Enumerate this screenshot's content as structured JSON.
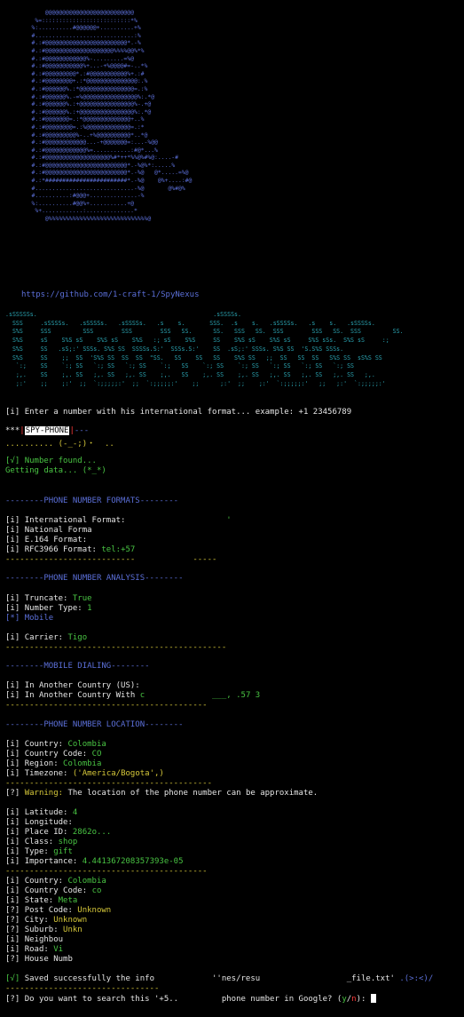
{
  "terminal": {
    "ascii_art": "       @@@@@@@@@@@@@@@@@@@@@@@@@@\n    %=::::::::::::::::::::::::::*%\n   %:..........#@@@@@@+..........+%\n   #.............................:%\n   #.:#@@@@@@@@@@@@@@@@@@@@@@@@*.-%\n   #.:#@@@@@@@@@@@@@@@@@@@@%%%%@@%*%\n   #.:#@@@@@@@@@@@@%-.........=%@\n   #.:#@@@@@@@@@@@%+...-+%@@@@#=-..*%\n   #.:#@@@@@@@@@*.:#@@@@@@@@@@@%+.:#\n   #.:#@@@@@@@@+.:*@@@@@@@@@@@@@@@:.%\n   #.:#@@@@@@%.:*@@@@@@@@@@@@@@@@=.:%\n   #.:#@@@@@@%.-=%@@@@@@@@@@@@@@@@%:.*@\n   #.:#@@@@@@%.:+@@@@@@@@@@@@@@@@%-.+@\n   #.:#@@@@@@%.:+@@@@@@@@@@@@@@@@%:.*@\n   #.:#@@@@@@@=.:*@@@@@@@@@@@@@@+..%\n   #.:#@@@@@@@@=.:%@@@@@@@@@@@@@=.:*\n   #.:#@@@@@@@@@%-..+%@@@@@@@@@@*..*@\n   #.:#@@@@@@@@@@@@...-+@@@@@@@=:...-%@@\n   #.:#@@@@@@@@@@@@%=...........:#@*...%\n   #.:#@@@@@@@@@@@@@@@@@@@%#*++*%%@%#%@:....-#\n   #.:#@@@@@@@@@@@@@@@@@@@@@@@@*.-%@%*:.....%\n   #.:#@@@@@@@@@@@@@@@@@@@@@@@@*.-%@   @*.....=%@\n   #.:*########################*.-%@    @%+....:#@\n   #.............................-%@       @%#@%\n   #..........:#@@@+..............-%\n   %:..........#@@%+...........+@\n    %+............:..............*\n       @%%%%%%%%%%%%%%%%%%%%%%%%%%%%%@",
    "repo_url": "https://github.com/1-craft-1/SpyNexus",
    "logo": ".sSSSSSs.                                                  .sSSSSs.\n  SSS     .sSSSSs.   .sSSSSs.   .sSSSSs.   .s    s.       SSS.  .s    s.   .sSSSSs.   .s    s.   .sSSSSs.\n  S%S     SSS         SSS        SSS        SSS   SS.      SS.   SSS   SS.  SSS        SSS   SS.  SSS         SS.\n  S%S     sS    S%S sS    S%S sS    S%S   :; sS    S%S     SS    S%S sS    S%S sS     S%S sSs.  S%S sS     :;\n  S%S     SS   .sS;:' SSSs. S%S SS  SSSSs.S:'  SSSs.S:'    SS  .sS;:' SSSs. S%S SS  'S.S%S SSSs.\n  S%S     SS    ;;  SS  'S%S SS  SS  SS  \"SS.   SS    SS   SS    S%S SS   ;;  SS   SS  SS   S%S SS  sS%S SS\n   `:;    SS    `:; SS   `:; SS   `:; SS    `:;   SS    `:; SS    `:; SS   `:; SS   `:; SS   `:; SS\n   ;,.    SS    ;,. SS   ;,. SS   ;,. SS    ;,.   SS    ;,. SS    ;,. SS   ;,. SS   ;,. SS   ;,. SS   ;,.\n   ;:'    ;;    ;:'  ;;  `:;;;;;:'  ;;  `:;;;;;:'    ;;      ;:'  ;;    ;:'  `:;;;;;:'   ;;   ;:'  `:;;;;;:'",
    "enter_prompt_tag": "[i]",
    "enter_prompt_text": "Enter a number with his international format... example: +1 23456789",
    "input_prefix": "***",
    "input_badge": "SPY-PHONE",
    "input_suffix": "---",
    "input_value": ".......... (-_-;)・  ..",
    "found_tag": "[√]",
    "found_text": "Number found...",
    "getting_data": "Getting data... (*_*)",
    "formats_header": "--------PHONE NUMBER FORMATS--------",
    "formats": [
      {
        "tag": "[i]",
        "label": "International Format:",
        "value": "                    '"
      },
      {
        "tag": "[i]",
        "label": "National Forma",
        "value": ""
      },
      {
        "tag": "[i]",
        "label": "E.164 Format:",
        "value": ""
      },
      {
        "tag": "[i]",
        "label": "RFC3966 Format:",
        "value": "tel:+57"
      }
    ],
    "formats_sep": "---------------------------            -----",
    "analysis_header": "--------PHONE NUMBER ANALYSIS--------",
    "truncate_label": "Truncate:",
    "truncate_value": "True",
    "number_type_label": "Number Type:",
    "number_type_value": "1",
    "mobile_tag": "[*]",
    "mobile_value": "Mobile",
    "carrier_label": "Carrier:",
    "carrier_value": "Tigo",
    "analysis_sep": "----------------------------------------------",
    "dialing_header": "--------MOBILE DIALING--------",
    "dial_us_label": "In Another Country (US):",
    "dial_other_label": "In Another Country With",
    "dial_other_value": "c              ___, .57 3",
    "dialing_sep": "------------------------------------------",
    "location_header": "--------PHONE NUMBER LOCATION--------",
    "country_label": "Country:",
    "country_value": "Colombia",
    "country_code_label": "Country Code:",
    "country_code_value": "CO",
    "region_label": "Region:",
    "region_value": "Colombia",
    "timezone_label": "Timezone:",
    "timezone_value": "('America/Bogota',)",
    "location_sep": "-------------------------------------------",
    "warning_tag": "[?]",
    "warning_label": "Warning:",
    "warning_text": "The location of the phone number can be approximate.",
    "geo": [
      {
        "tag": "[i]",
        "label": "Latitude:",
        "value": "4",
        "color": "green"
      },
      {
        "tag": "[i]",
        "label": "Longitude:",
        "value": "",
        "color": "green"
      },
      {
        "tag": "[i]",
        "label": "Place ID:",
        "value": "2862o...",
        "color": "green"
      },
      {
        "tag": "[i]",
        "label": "Class:",
        "value": "shop",
        "color": "green"
      },
      {
        "tag": "[i]",
        "label": "Type:",
        "value": "gift",
        "color": "green"
      },
      {
        "tag": "[i]",
        "label": "Importance:",
        "value": "4.441367208357393e-05",
        "color": "green"
      }
    ],
    "geo_sep": "------------------------------------------",
    "addr": [
      {
        "tag": "[i]",
        "label": "Country:",
        "value": "Colombia",
        "color": "green"
      },
      {
        "tag": "[i]",
        "label": "Country Code:",
        "value": "co",
        "color": "green"
      },
      {
        "tag": "[i]",
        "label": "State:",
        "value": "Meta",
        "color": "green"
      },
      {
        "tag": "[?]",
        "label": "Post Code:",
        "value": "Unknown",
        "color": "yellow"
      },
      {
        "tag": "[?]",
        "label": "City:",
        "value": "Unknown",
        "color": "yellow"
      },
      {
        "tag": "[?]",
        "label": "Suburb:",
        "value": "Unkn",
        "color": "yellow"
      },
      {
        "tag": "[i]",
        "label": "Neighbou",
        "value": "",
        "color": "green"
      },
      {
        "tag": "[i]",
        "label": "Road:",
        "value": "Vi",
        "color": "green"
      },
      {
        "tag": "[?]",
        "label": "House Numb",
        "value": "",
        "color": "yellow"
      }
    ],
    "saved_tag": "[√]",
    "saved_text": "Saved successfully the info            ''nes/resu                  _file.txt'",
    "saved_face": " .(>:<)/",
    "final_sep": "--------------------------------",
    "question_tag": "[?]",
    "question_text": "Do you want to search this '+5..         phone number in Google? (",
    "yes_option": "y",
    "slash": "/",
    "no_option": "n",
    "question_end": "):"
  },
  "colors": {
    "background": "#000000",
    "text": "#e6e6e6",
    "blue": "#5b6fd8",
    "green": "#49c443",
    "yellow": "#d6c83a",
    "red": "#ff3b3b",
    "cyan": "#2aa2b0"
  }
}
